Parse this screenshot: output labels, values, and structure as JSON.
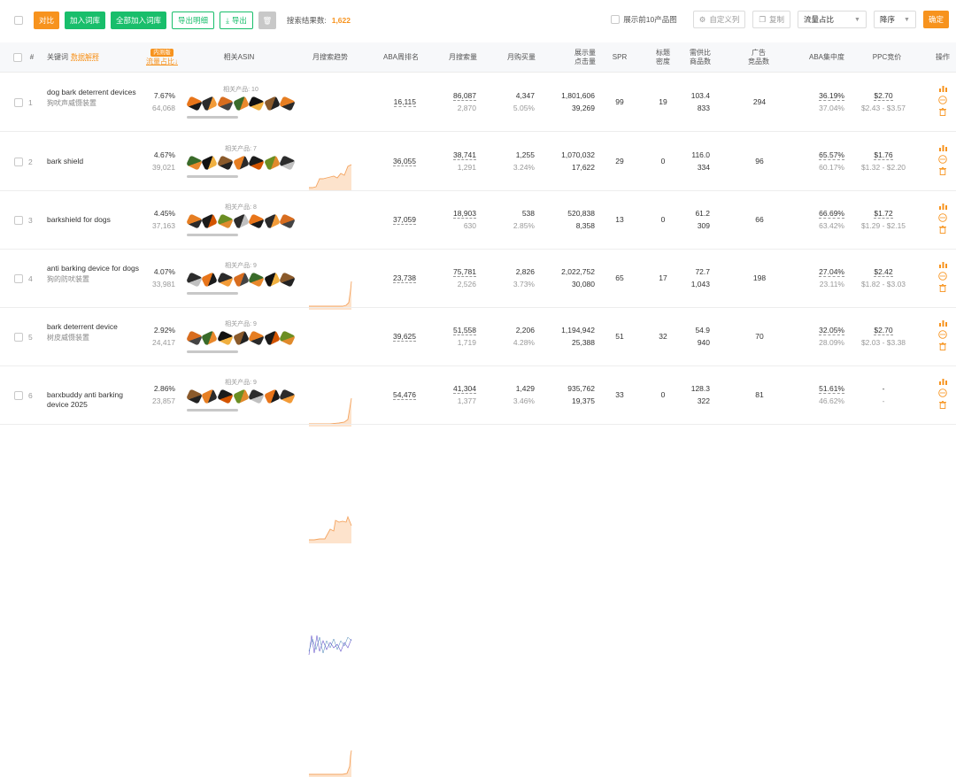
{
  "toolbar": {
    "compare": "对比",
    "add_lib": "加入词库",
    "add_all_lib": "全部加入词库",
    "export_detail": "导出明细",
    "export": "导出",
    "search_count_label": "搜索结果数:",
    "search_count_value": "1,622",
    "show_top10": "展示前10产品图",
    "custom_cols": "自定义列",
    "copy": "复制",
    "sort_field": "流量占比",
    "sort_order": "降序",
    "confirm": "确定"
  },
  "headers": {
    "index": "#",
    "keyword": "关键词",
    "keyword_link": "数据解释",
    "flow_badge": "内测版",
    "flow": "流量占比↓",
    "asin": "相关ASIN",
    "trend": "月搜索趋势",
    "aba_rank": "ABA周排名",
    "monthly_search": "月搜索量",
    "monthly_purchase": "月购买量",
    "impressions_l1": "展示量",
    "impressions_l2": "点击量",
    "spr": "SPR",
    "title_density_l1": "标题",
    "title_density_l2": "密度",
    "supply_demand_l1": "需供比",
    "supply_demand_l2": "商品数",
    "ad_products_l1": "广告",
    "ad_products_l2": "竞品数",
    "aba_concentration": "ABA集中度",
    "ppc": "PPC竞价",
    "ops": "操作"
  },
  "rows": [
    {
      "idx": "1",
      "kw": "dog bark deterrent devices",
      "kw_sub": "狗吠声威慑装置",
      "flow": "7.67%",
      "flow_sub": "64,068",
      "asin_label": "相关产品: 10",
      "aba_rank": "16,115",
      "ms": "86,087",
      "ms_sub": "2,870",
      "mp": "4,347",
      "mp_sub": "5.05%",
      "imp": "1,801,606",
      "clicks": "39,269",
      "spr": "99",
      "td": "19",
      "sd": "103.4",
      "sd_sub": "833",
      "ad": "294",
      "aba_c": "36.19%",
      "aba_c_sub": "37.04%",
      "ppc": "$2.70",
      "ppc_range": "$2.43 - $3.57"
    },
    {
      "idx": "2",
      "kw": "bark shield",
      "kw_sub": "",
      "flow": "4.67%",
      "flow_sub": "39,021",
      "asin_label": "相关产品: 7",
      "aba_rank": "36,055",
      "ms": "38,741",
      "ms_sub": "1,291",
      "mp": "1,255",
      "mp_sub": "3.24%",
      "imp": "1,070,032",
      "clicks": "17,622",
      "spr": "29",
      "td": "0",
      "sd": "116.0",
      "sd_sub": "334",
      "ad": "96",
      "aba_c": "65.57%",
      "aba_c_sub": "60.17%",
      "ppc": "$1.76",
      "ppc_range": "$1.32 - $2.20"
    },
    {
      "idx": "3",
      "kw": "barkshield for dogs",
      "kw_sub": "",
      "flow": "4.45%",
      "flow_sub": "37,163",
      "asin_label": "相关产品: 8",
      "aba_rank": "37,059",
      "ms": "18,903",
      "ms_sub": "630",
      "mp": "538",
      "mp_sub": "2.85%",
      "imp": "520,838",
      "clicks": "8,358",
      "spr": "13",
      "td": "0",
      "sd": "61.2",
      "sd_sub": "309",
      "ad": "66",
      "aba_c": "66.69%",
      "aba_c_sub": "63.42%",
      "ppc": "$1.72",
      "ppc_range": "$1.29 - $2.15"
    },
    {
      "idx": "4",
      "kw": "anti barking device for dogs",
      "kw_sub": "狗的防吠装置",
      "flow": "4.07%",
      "flow_sub": "33,981",
      "asin_label": "相关产品: 9",
      "aba_rank": "23,738",
      "ms": "75,781",
      "ms_sub": "2,526",
      "mp": "2,826",
      "mp_sub": "3.73%",
      "imp": "2,022,752",
      "clicks": "30,080",
      "spr": "65",
      "td": "17",
      "sd": "72.7",
      "sd_sub": "1,043",
      "ad": "198",
      "aba_c": "27.04%",
      "aba_c_sub": "23.11%",
      "ppc": "$2.42",
      "ppc_range": "$1.82 - $3.03"
    },
    {
      "idx": "5",
      "kw": "bark deterrent device",
      "kw_sub": "树皮威慑装置",
      "flow": "2.92%",
      "flow_sub": "24,417",
      "asin_label": "相关产品: 9",
      "aba_rank": "39,625",
      "ms": "51,558",
      "ms_sub": "1,719",
      "mp": "2,206",
      "mp_sub": "4.28%",
      "imp": "1,194,942",
      "clicks": "25,388",
      "spr": "51",
      "td": "32",
      "sd": "54.9",
      "sd_sub": "940",
      "ad": "70",
      "aba_c": "32.05%",
      "aba_c_sub": "28.09%",
      "ppc": "$2.70",
      "ppc_range": "$2.03 - $3.38"
    },
    {
      "idx": "6",
      "kw": "barxbuddy anti barking device 2025",
      "kw_sub": "",
      "flow": "2.86%",
      "flow_sub": "23,857",
      "asin_label": "相关产品: 9",
      "aba_rank": "54,476",
      "ms": "41,304",
      "ms_sub": "1,377",
      "mp": "1,429",
      "mp_sub": "3.46%",
      "imp": "935,762",
      "clicks": "19,375",
      "spr": "33",
      "td": "0",
      "sd": "128.3",
      "sd_sub": "322",
      "ad": "81",
      "aba_c": "51.61%",
      "aba_c_sub": "46.62%",
      "ppc": "-",
      "ppc_range": "-"
    }
  ],
  "colors": {
    "accent": "#f7931e",
    "green": "#19be6b",
    "spark": "#f4a460"
  }
}
